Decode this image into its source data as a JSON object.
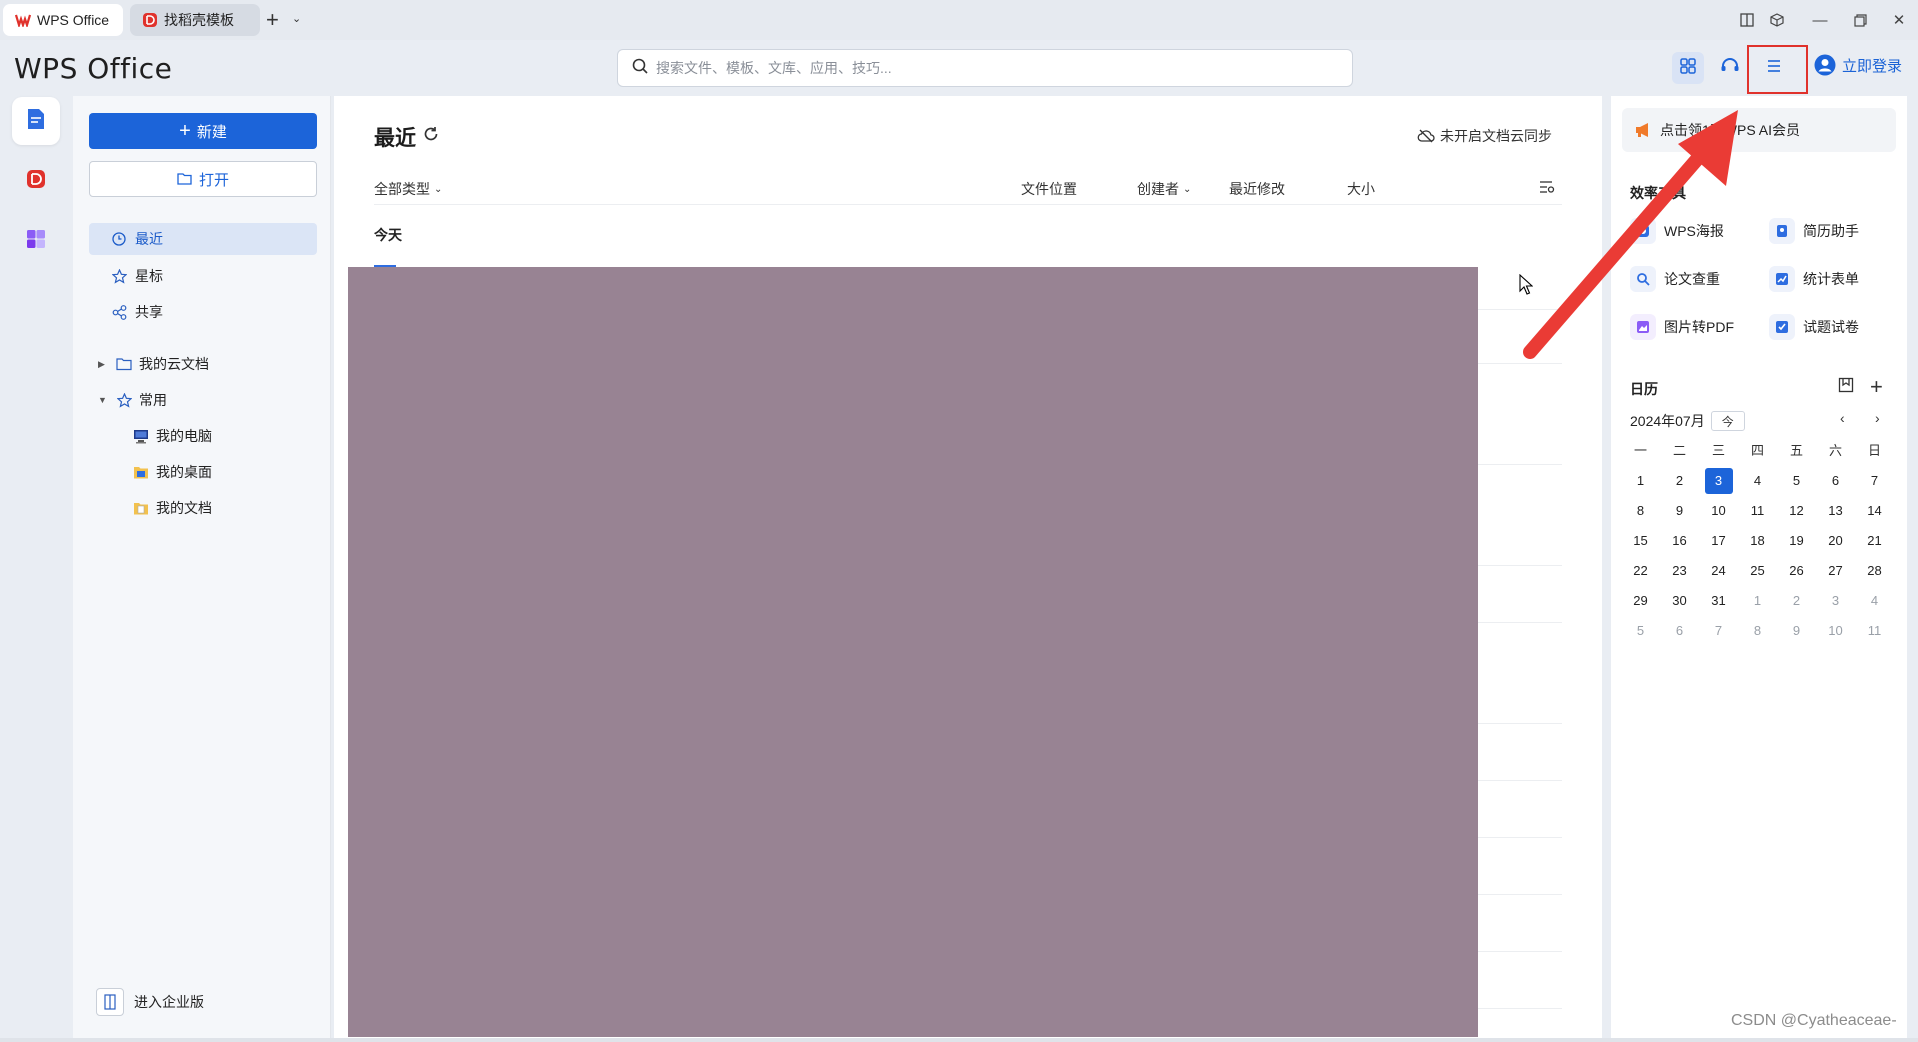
{
  "tabs": [
    {
      "label": "WPS Office",
      "icon": "wps-logo-icon"
    },
    {
      "label": "找稻壳模板",
      "icon": "docer-icon"
    }
  ],
  "app": {
    "brand": "WPS Office",
    "search_placeholder": "搜索文件、模板、文库、应用、技巧...",
    "login_label": "立即登录"
  },
  "sidebar": {
    "new_label": "新建",
    "open_label": "打开",
    "nav": [
      "最近",
      "星标",
      "共享"
    ],
    "cloud_docs": "我的云文档",
    "common": "常用",
    "common_items": [
      "我的电脑",
      "我的桌面",
      "我的文档"
    ],
    "enterprise": "进入企业版"
  },
  "main": {
    "title": "最近",
    "sync_status": "未开启文档云同步",
    "columns": {
      "type_filter": "全部类型",
      "location": "文件位置",
      "creator": "创建者",
      "modified": "最近修改",
      "size": "大小"
    },
    "group_today": "今天"
  },
  "right_panel": {
    "promo": "点击领1天WPS AI会员",
    "tools_title": "效率工具",
    "tools": [
      "WPS海报",
      "简历助手",
      "论文查重",
      "统计表单",
      "图片转PDF",
      "试题试卷"
    ],
    "calendar_title": "日历",
    "calendar_month": "2024年07月",
    "today_button": "今",
    "weekdays": [
      "一",
      "二",
      "三",
      "四",
      "五",
      "六",
      "日"
    ],
    "weeks": [
      [
        "1",
        "2",
        "3",
        "4",
        "5",
        "6",
        "7"
      ],
      [
        "8",
        "9",
        "10",
        "11",
        "12",
        "13",
        "14"
      ],
      [
        "15",
        "16",
        "17",
        "18",
        "19",
        "20",
        "21"
      ],
      [
        "22",
        "23",
        "24",
        "25",
        "26",
        "27",
        "28"
      ],
      [
        "29",
        "30",
        "31",
        "1",
        "2",
        "3",
        "4"
      ],
      [
        "5",
        "6",
        "7",
        "8",
        "9",
        "10",
        "11"
      ]
    ],
    "selected_day": "3"
  },
  "watermark": "CSDN @Cyatheaceae-",
  "colors": {
    "accent": "#1c64d9",
    "annotation": "#e0322c",
    "redacted": "#988393"
  }
}
